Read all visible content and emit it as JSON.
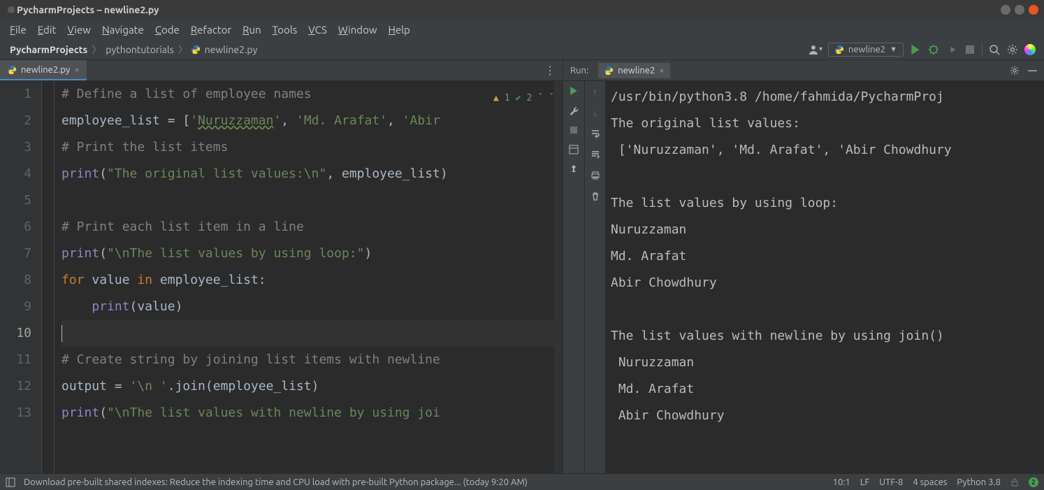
{
  "window": {
    "title": "PycharmProjects – newline2.py"
  },
  "menu": [
    "File",
    "Edit",
    "View",
    "Navigate",
    "Code",
    "Refactor",
    "Run",
    "Tools",
    "VCS",
    "Window",
    "Help"
  ],
  "breadcrumb": {
    "items": [
      "PycharmProjects",
      "pythontutorials",
      "newline2.py"
    ]
  },
  "runconfig": {
    "name": "newline2"
  },
  "editor": {
    "tab": {
      "name": "newline2.py"
    },
    "inspections": {
      "warnings": "1",
      "passes": "2"
    },
    "lines": [
      {
        "n": "1",
        "seg": [
          {
            "c": "c-comment",
            "t": "# Define a list of employee names"
          }
        ]
      },
      {
        "n": "2",
        "seg": [
          {
            "c": "",
            "t": "employee_list = ["
          },
          {
            "c": "c-str",
            "t": "'"
          },
          {
            "c": "c-typo",
            "t": "Nuruzzaman"
          },
          {
            "c": "c-str",
            "t": "'"
          },
          {
            "c": "",
            "t": ", "
          },
          {
            "c": "c-str",
            "t": "'Md. Arafat'"
          },
          {
            "c": "",
            "t": ", "
          },
          {
            "c": "c-str",
            "t": "'Abir"
          }
        ]
      },
      {
        "n": "3",
        "seg": [
          {
            "c": "c-comment",
            "t": "# Print the list items"
          }
        ]
      },
      {
        "n": "4",
        "seg": [
          {
            "c": "c-builtin",
            "t": "print"
          },
          {
            "c": "",
            "t": "("
          },
          {
            "c": "c-str",
            "t": "\"The original list values:\\n\""
          },
          {
            "c": "",
            "t": ", employee_list)"
          }
        ]
      },
      {
        "n": "5",
        "seg": []
      },
      {
        "n": "6",
        "seg": [
          {
            "c": "c-comment",
            "t": "# Print each list item in a line"
          }
        ]
      },
      {
        "n": "7",
        "seg": [
          {
            "c": "c-builtin",
            "t": "print"
          },
          {
            "c": "",
            "t": "("
          },
          {
            "c": "c-str",
            "t": "\"\\nThe list values by using loop:\""
          },
          {
            "c": "",
            "t": ")"
          }
        ]
      },
      {
        "n": "8",
        "seg": [
          {
            "c": "c-kw",
            "t": "for "
          },
          {
            "c": "",
            "t": "value "
          },
          {
            "c": "c-kw",
            "t": "in "
          },
          {
            "c": "",
            "t": "employee_list:"
          }
        ]
      },
      {
        "n": "9",
        "seg": [
          {
            "c": "",
            "t": "    "
          },
          {
            "c": "c-builtin",
            "t": "print"
          },
          {
            "c": "",
            "t": "(value)"
          }
        ]
      },
      {
        "n": "10",
        "current": true,
        "seg": []
      },
      {
        "n": "11",
        "seg": [
          {
            "c": "c-comment",
            "t": "# Create string by joining list items with newline"
          }
        ]
      },
      {
        "n": "12",
        "seg": [
          {
            "c": "",
            "t": "output = "
          },
          {
            "c": "c-str",
            "t": "'\\n '"
          },
          {
            "c": "",
            "t": ".join(employee_list)"
          }
        ]
      },
      {
        "n": "13",
        "seg": [
          {
            "c": "c-builtin",
            "t": "print"
          },
          {
            "c": "",
            "t": "("
          },
          {
            "c": "c-str",
            "t": "\"\\nThe list values with newline by using joi"
          }
        ]
      }
    ]
  },
  "run": {
    "label": "Run:",
    "tab": "newline2",
    "output": [
      "/usr/bin/python3.8 /home/fahmida/PycharmProj",
      "The original list values:",
      " ['Nuruzzaman', 'Md. Arafat', 'Abir Chowdhury",
      "",
      "The list values by using loop:",
      "Nuruzzaman",
      "Md. Arafat",
      "Abir Chowdhury",
      "",
      "The list values with newline by using join()",
      " Nuruzzaman",
      " Md. Arafat",
      " Abir Chowdhury"
    ]
  },
  "statusbar": {
    "msg": "Download pre-built shared indexes: Reduce the indexing time and CPU load with pre-built Python package... (today 9:20 AM)",
    "pos": "10:1",
    "le": "LF",
    "enc": "UTF-8",
    "indent": "4 spaces",
    "interp": "Python 3.8",
    "badge": "2"
  }
}
